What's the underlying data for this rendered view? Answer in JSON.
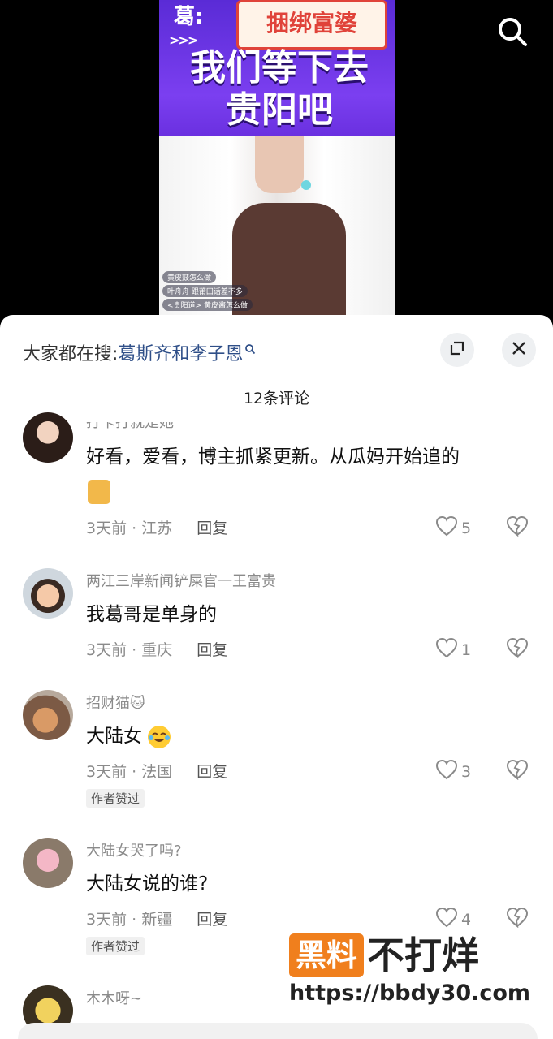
{
  "video": {
    "banner_speaker": "葛:",
    "banner_top": "捆绑富婆",
    "banner_arrows": ">>>",
    "banner_main_line1": "我们等下去",
    "banner_main_line2": "贵阳吧",
    "live_comments": [
      "黄皮鼓怎么做",
      "叶舟舟 跟莆田话差不多",
      "<贵阳道> 黄皮酱怎么做"
    ]
  },
  "sheet": {
    "search_prefix": "大家都在搜:",
    "search_link": "葛斯齐和李子恩",
    "comment_count": "12条评论"
  },
  "comments": [
    {
      "name": "打卡打就是她",
      "text": "好看，爱看，博主抓紧更新。从瓜妈开始追的",
      "time_loc": "3天前 · 江苏",
      "reply": "回复",
      "likes": "5",
      "author_liked": ""
    },
    {
      "name": "两江三岸新闻铲屎官一王富贵",
      "text": "我葛哥是单身的",
      "time_loc": "3天前 · 重庆",
      "reply": "回复",
      "likes": "1",
      "author_liked": ""
    },
    {
      "name": "招财猫🐱",
      "text": "大陆女",
      "time_loc": "3天前 · 法国",
      "reply": "回复",
      "likes": "3",
      "author_liked": "作者赞过"
    },
    {
      "name": "大陆女哭了吗?",
      "text": "大陆女说的谁?",
      "time_loc": "3天前 · 新疆",
      "reply": "回复",
      "likes": "4",
      "author_liked": "作者赞过"
    },
    {
      "name": "木木呀~"
    }
  ],
  "watermark": {
    "left": "黑料",
    "right": "不打烊",
    "url": "https://bbdy30.com"
  },
  "colors": {
    "link": "#2f4f88",
    "watermark_orange": "#f07f1d",
    "banner_purple": "#6a30e0"
  }
}
